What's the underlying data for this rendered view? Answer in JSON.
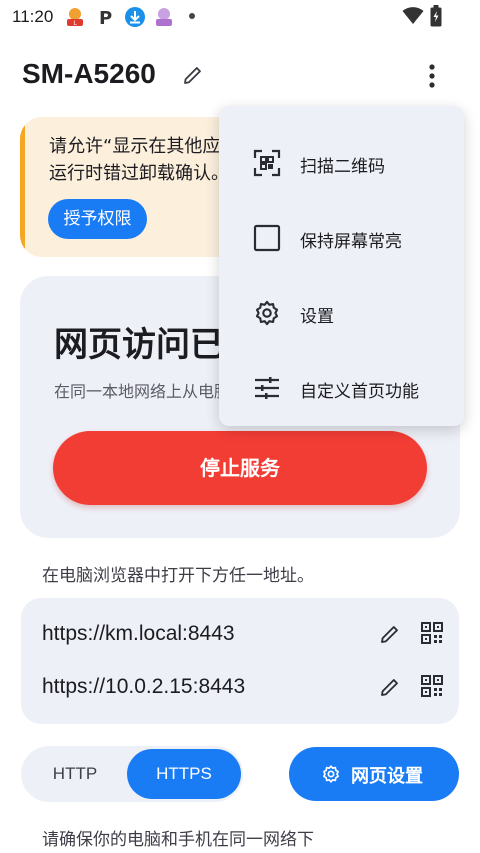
{
  "status_bar": {
    "time": "11:20"
  },
  "app_bar": {
    "title": "SM-A5260"
  },
  "permission_card": {
    "text": "请允许“显示在其他应用的上层”权限，以避免后台运行时错过卸载确认。",
    "button": "授予权限"
  },
  "service_card": {
    "title": "网页访问已开启",
    "subtitle": "在同一本地网络上从电脑浏览器访问",
    "stop_button": "停止服务"
  },
  "instructions": "在电脑浏览器中打开下方任一地址。",
  "urls": [
    {
      "address": "https://km.local:8443"
    },
    {
      "address": "https://10.0.2.15:8443"
    }
  ],
  "protocol_toggle": {
    "options": [
      "HTTP",
      "HTTPS"
    ],
    "selected": "HTTPS"
  },
  "web_settings_button": "网页设置",
  "bottom_note": "请确保你的电脑和手机在同一网络下",
  "menu": {
    "items": [
      {
        "label": "扫描二维码",
        "icon": "qr-scan-icon"
      },
      {
        "label": "保持屏幕常亮",
        "icon": "checkbox-icon"
      },
      {
        "label": "设置",
        "icon": "gear-icon"
      },
      {
        "label": "自定义首页功能",
        "icon": "tune-icon"
      }
    ]
  },
  "colors": {
    "accent": "#1a7cf5",
    "danger": "#f23d35",
    "warning_bg": "#fcefdc",
    "warning_bar": "#f5a623",
    "card_bg": "#eef0f8"
  }
}
